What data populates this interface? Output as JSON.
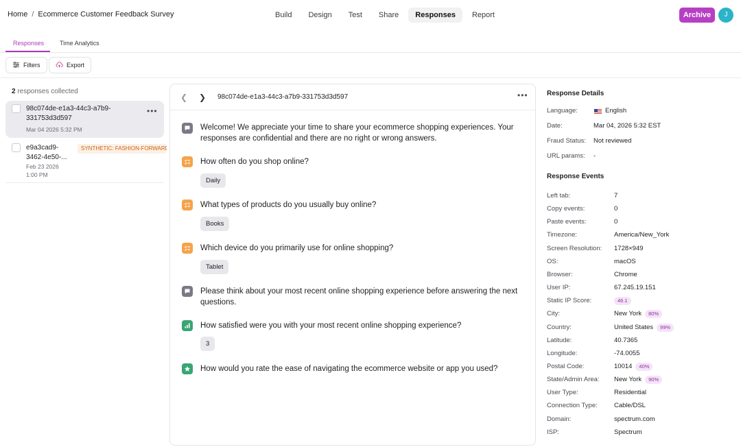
{
  "breadcrumb": {
    "home": "Home",
    "separator": "/",
    "survey": "Ecommerce Customer Feedback Survey"
  },
  "nav": [
    {
      "label": "Build",
      "active": false
    },
    {
      "label": "Design",
      "active": false
    },
    {
      "label": "Test",
      "active": false
    },
    {
      "label": "Share",
      "active": false
    },
    {
      "label": "Responses",
      "active": true
    },
    {
      "label": "Report",
      "active": false
    }
  ],
  "archive_label": "Archive",
  "avatar_initial": "J",
  "subtabs": {
    "responses": "Responses",
    "time_analytics": "Time Analytics"
  },
  "toolbar": {
    "filters": "Filters",
    "export": "Export"
  },
  "list": {
    "count": "2",
    "count_suffix": "responses collected",
    "items": [
      {
        "id_line1": "98c074de-e1a3-44c3-a7b9-",
        "id_line2": "331753d3d597",
        "date": "Mar 04 2026 5:32 PM"
      },
      {
        "id_line1": "e9a3cad9-",
        "id_line2": "3462-4e50-...",
        "tag": "SYNTHETIC: FASHION-FORWARD",
        "date_line1": "Feb 23 2026",
        "date_line2": "1:00 PM"
      }
    ]
  },
  "detail": {
    "response_id": "98c074de-e1a3-44c3-a7b9-331753d3d597",
    "questions": [
      {
        "icon": "message-icon",
        "text": "Welcome! We appreciate your time to share your ecommerce shopping experiences. Your responses are confidential and there are no right or wrong answers."
      },
      {
        "icon": "list-icon",
        "text": "How often do you shop online?",
        "answer": "Daily"
      },
      {
        "icon": "list-icon",
        "text": "What types of products do you usually buy online?",
        "answer": "Books"
      },
      {
        "icon": "list-icon",
        "text": "Which device do you primarily use for online shopping?",
        "answer": "Tablet"
      },
      {
        "icon": "message-icon",
        "text": "Please think about your most recent online shopping experience before answering the next questions."
      },
      {
        "icon": "bar-chart-icon",
        "text": "How satisfied were you with your most recent online shopping experience?",
        "answer": "3"
      },
      {
        "icon": "star-icon",
        "text": "How would you rate the ease of navigating the ecommerce website or app you used?"
      }
    ]
  },
  "details_panel": {
    "title": "Response Details",
    "rows": [
      {
        "label": "Language:",
        "value": "English"
      },
      {
        "label": "Date:",
        "value": "Mar 04, 2026 5:32 EST"
      },
      {
        "label": "Fraud Status:",
        "value": "Not reviewed"
      },
      {
        "label": "URL params:",
        "value": "-"
      }
    ]
  },
  "events_panel": {
    "title": "Response Events",
    "rows": [
      {
        "label": "Left tab:",
        "value": "7"
      },
      {
        "label": "Copy events:",
        "value": "0"
      },
      {
        "label": "Paste events:",
        "value": "0"
      },
      {
        "label": "Timezone:",
        "value": "America/New_York"
      },
      {
        "label": "Screen Resolution:",
        "value": "1728×949"
      },
      {
        "label": "OS:",
        "value": "macOS"
      },
      {
        "label": "Browser:",
        "value": "Chrome"
      },
      {
        "label": "User IP:",
        "value": "67.245.19.151"
      },
      {
        "label": "Static IP Score:",
        "value": "",
        "badge": "46.1"
      },
      {
        "label": "City:",
        "value": "New York",
        "badge": "80%"
      },
      {
        "label": "Country:",
        "value": "United States",
        "badge": "99%"
      },
      {
        "label": "Latitude:",
        "value": "40.7365"
      },
      {
        "label": "Longitude:",
        "value": "-74.0055"
      },
      {
        "label": "Postal Code:",
        "value": "10014",
        "badge": "40%"
      },
      {
        "label": "State/Admin Area:",
        "value": "New York",
        "badge": "90%"
      },
      {
        "label": "User Type:",
        "value": "Residential"
      },
      {
        "label": "Connection Type:",
        "value": "Cable/DSL"
      },
      {
        "label": "Domain:",
        "value": "spectrum.com"
      },
      {
        "label": "ISP:",
        "value": "Spectrum"
      }
    ]
  },
  "colors": {
    "accent": "#b73fc4",
    "avatar": "#2bb3c8",
    "tag_text": "#c4641a"
  }
}
